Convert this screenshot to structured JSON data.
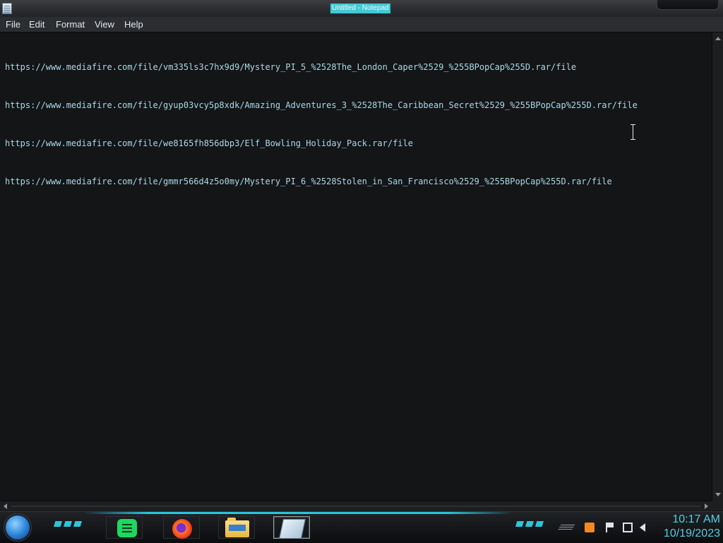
{
  "window": {
    "title": "Untitled - Notepad"
  },
  "menu": {
    "items": [
      "File",
      "Edit",
      "Format",
      "View",
      "Help"
    ]
  },
  "editor": {
    "lines": [
      "https://www.mediafire.com/file/vm335ls3c7hx9d9/Mystery_PI_5_%2528The_London_Caper%2529_%255BPopCap%255D.rar/file",
      "https://www.mediafire.com/file/gyup03vcy5p8xdk/Amazing_Adventures_3_%2528The_Caribbean_Secret%2529_%255BPopCap%255D.rar/file",
      "https://www.mediafire.com/file/we8165fh856dbp3/Elf_Bowling_Holiday_Pack.rar/file",
      "https://www.mediafire.com/file/gmmr566d4z5o0my/Mystery_PI_6_%2528Stolen_in_San_Francisco%2529_%255BPopCap%255D.rar/file"
    ]
  },
  "taskbar": {
    "apps": [
      {
        "icon": "spotify-icon"
      },
      {
        "icon": "firefox-icon"
      },
      {
        "icon": "file-explorer-icon"
      },
      {
        "icon": "notepad-icon",
        "active": true
      }
    ],
    "tray_icons": [
      "show-hidden-icons",
      "orange-app-icon",
      "action-center-flag-icon",
      "network-icon",
      "volume-icon"
    ],
    "clock": {
      "time": "10:17 AM",
      "date": "10/19/2023"
    }
  },
  "colors": {
    "accent": "#2fc4d8",
    "text": "#a9d8e6",
    "background": "#141517"
  }
}
